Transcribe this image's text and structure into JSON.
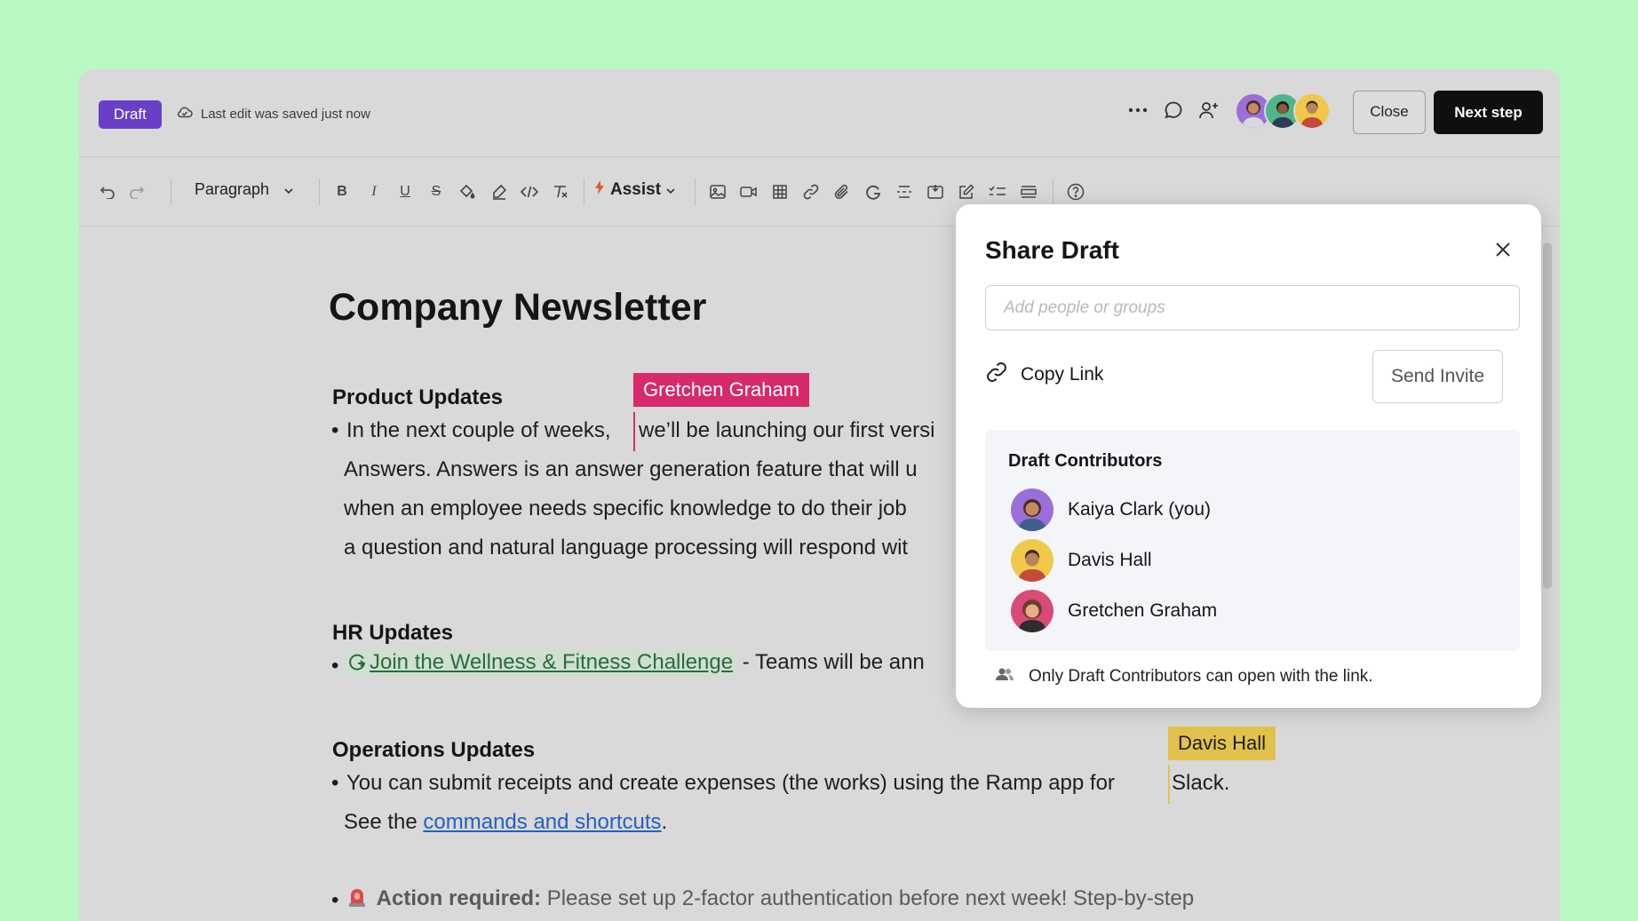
{
  "header": {
    "status_badge": "Draft",
    "save_status": "Last edit was saved just now",
    "close_label": "Close",
    "next_label": "Next step"
  },
  "toolbar": {
    "paragraph_label": "Paragraph",
    "assist_label": "Assist"
  },
  "doc": {
    "title": "Company Newsletter",
    "product_heading": "Product Updates",
    "product_lines": [
      "In the next couple of weeks,",
      "we’ll be launching our first versi",
      "Answers. Answers is an answer generation feature that will u",
      "when an employee needs specific knowledge to do their job",
      "a question and natural language processing will respond wit"
    ],
    "hr_heading": "HR Updates",
    "hr_link": "Join the Wellness & Fitness Challenge",
    "hr_rest": "- Teams will be ann",
    "ops_heading": "Operations Updates",
    "ops_line1": "You can submit receipts and create expenses (the works) using the Ramp app for",
    "ops_line1_end": "Slack.",
    "ops_line2_pre": "See the",
    "ops_link": "commands and shortcuts",
    "ops_line2_post": ".",
    "action_label": "Action required:",
    "action_text": "Please set up 2-factor authentication before next week! Step-by-step"
  },
  "cursors": {
    "pink_name": "Gretchen Graham",
    "yellow_name": "Davis Hall"
  },
  "share_dialog": {
    "title": "Share Draft",
    "input_placeholder": "Add people or groups",
    "copy_link": "Copy Link",
    "send_invite": "Send Invite",
    "contributors_heading": "Draft Contributors",
    "contributors": [
      {
        "name": "Kaiya Clark (you)"
      },
      {
        "name": "Davis Hall"
      },
      {
        "name": "Gretchen Graham"
      }
    ],
    "access_note": "Only Draft Contributors can open with the link."
  },
  "colors": {
    "background": "#b9f7c3",
    "badge_purple": "#6a3fc8",
    "cursor_pink": "#d62a6b",
    "cursor_yellow": "#e2c24d",
    "link_blue": "#2260c4",
    "link_green": "#2a6b3a"
  }
}
